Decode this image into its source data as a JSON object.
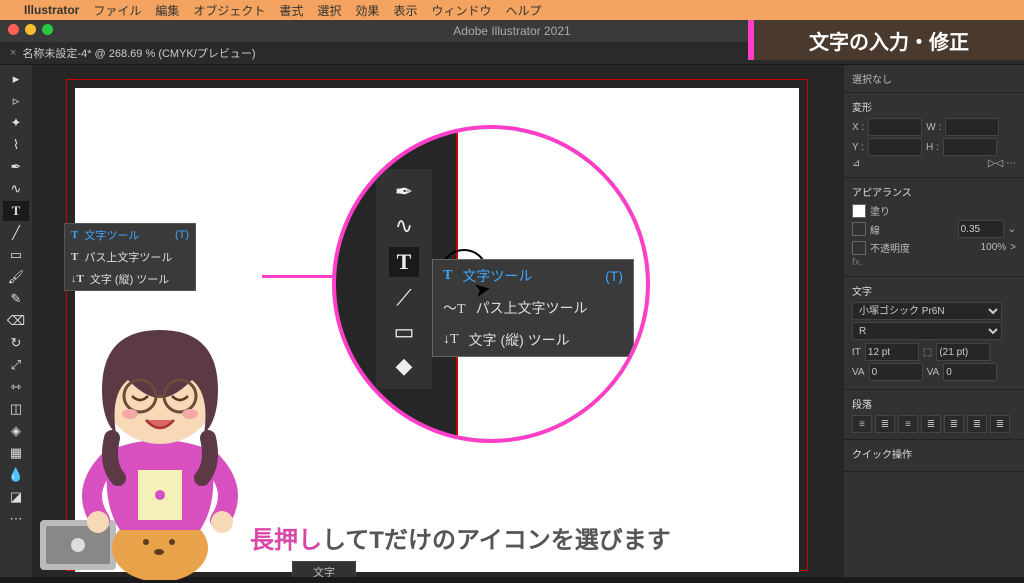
{
  "menubar": {
    "app": "Illustrator",
    "items": [
      "ファイル",
      "編集",
      "オブジェクト",
      "書式",
      "選択",
      "効果",
      "表示",
      "ウィンドウ",
      "ヘルプ"
    ]
  },
  "window": {
    "title": "Adobe Illustrator 2021"
  },
  "doc": {
    "tab": "名称未設定-4* @ 268.69 % (CMYK/プレビュー)"
  },
  "flyout": {
    "items": [
      {
        "icon": "T",
        "label": "文字ツール",
        "shortcut": "(T)",
        "hi": true
      },
      {
        "icon": "T",
        "label": "パス上文字ツール",
        "shortcut": "",
        "hi": false
      },
      {
        "icon": "↓T",
        "label": "文字 (縦) ツール",
        "shortcut": "",
        "hi": false
      }
    ]
  },
  "banner": "文字の入力・修正",
  "caption": {
    "em": "長押し",
    "rest": "してTだけのアイコンを選びます"
  },
  "panels": {
    "noSelection": "選択なし",
    "transform": {
      "hd": "変形",
      "x": "X :",
      "y": "Y :",
      "w": "W :",
      "h": "H :"
    },
    "appearance": {
      "hd": "アピアランス",
      "fill": "塗り",
      "stroke": "線",
      "strokeVal": "0.35",
      "opacity": "不透明度",
      "opVal": "100%",
      "fx": "fx."
    },
    "text": {
      "hd": "文字",
      "font": "小塚ゴシック Pr6N",
      "weight": "R",
      "size": "12 pt",
      "leading": "(21 pt)",
      "track": "0",
      "kern": "0"
    },
    "para": {
      "hd": "段落"
    },
    "quick": "クイック操作"
  },
  "bottombar": "文字"
}
